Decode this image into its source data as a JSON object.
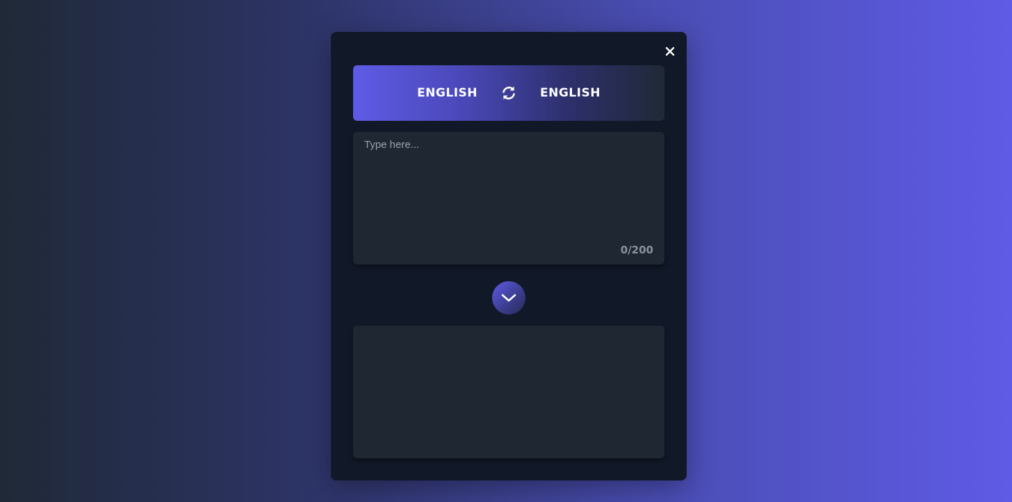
{
  "translator": {
    "source_language": "ENGLISH",
    "target_language": "ENGLISH",
    "input_placeholder": "Type here...",
    "input_value": "",
    "char_counter": "0/200",
    "output_text": ""
  },
  "icons": {
    "close": "close-icon",
    "swap": "swap-icon",
    "translate": "chevron-down-icon"
  },
  "colors": {
    "accent": "#5f5be6",
    "panel": "#111827",
    "field": "#1f2733"
  }
}
